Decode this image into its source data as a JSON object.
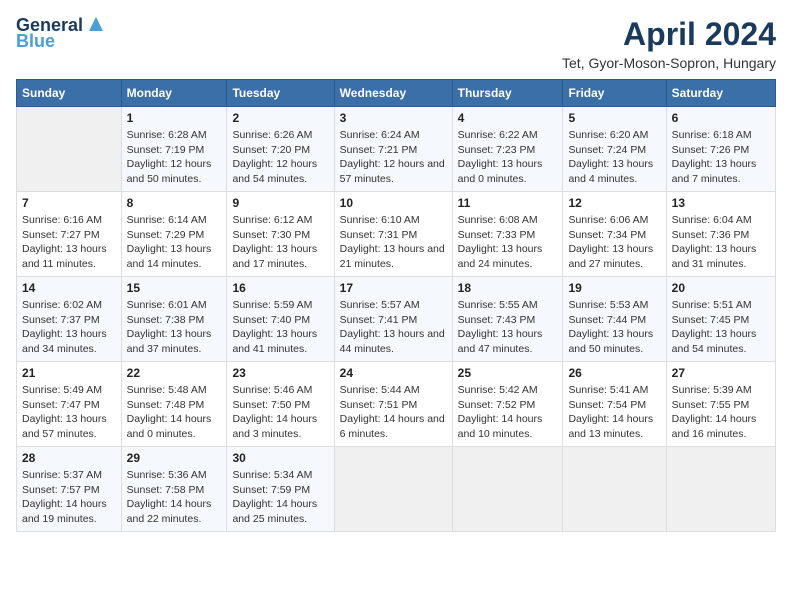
{
  "logo": {
    "line1": "General",
    "line2": "Blue"
  },
  "title": "April 2024",
  "location": "Tet, Gyor-Moson-Sopron, Hungary",
  "weekdays": [
    "Sunday",
    "Monday",
    "Tuesday",
    "Wednesday",
    "Thursday",
    "Friday",
    "Saturday"
  ],
  "weeks": [
    [
      {
        "day": "",
        "sunrise": "",
        "sunset": "",
        "daylight": ""
      },
      {
        "day": "1",
        "sunrise": "Sunrise: 6:28 AM",
        "sunset": "Sunset: 7:19 PM",
        "daylight": "Daylight: 12 hours and 50 minutes."
      },
      {
        "day": "2",
        "sunrise": "Sunrise: 6:26 AM",
        "sunset": "Sunset: 7:20 PM",
        "daylight": "Daylight: 12 hours and 54 minutes."
      },
      {
        "day": "3",
        "sunrise": "Sunrise: 6:24 AM",
        "sunset": "Sunset: 7:21 PM",
        "daylight": "Daylight: 12 hours and 57 minutes."
      },
      {
        "day": "4",
        "sunrise": "Sunrise: 6:22 AM",
        "sunset": "Sunset: 7:23 PM",
        "daylight": "Daylight: 13 hours and 0 minutes."
      },
      {
        "day": "5",
        "sunrise": "Sunrise: 6:20 AM",
        "sunset": "Sunset: 7:24 PM",
        "daylight": "Daylight: 13 hours and 4 minutes."
      },
      {
        "day": "6",
        "sunrise": "Sunrise: 6:18 AM",
        "sunset": "Sunset: 7:26 PM",
        "daylight": "Daylight: 13 hours and 7 minutes."
      }
    ],
    [
      {
        "day": "7",
        "sunrise": "Sunrise: 6:16 AM",
        "sunset": "Sunset: 7:27 PM",
        "daylight": "Daylight: 13 hours and 11 minutes."
      },
      {
        "day": "8",
        "sunrise": "Sunrise: 6:14 AM",
        "sunset": "Sunset: 7:29 PM",
        "daylight": "Daylight: 13 hours and 14 minutes."
      },
      {
        "day": "9",
        "sunrise": "Sunrise: 6:12 AM",
        "sunset": "Sunset: 7:30 PM",
        "daylight": "Daylight: 13 hours and 17 minutes."
      },
      {
        "day": "10",
        "sunrise": "Sunrise: 6:10 AM",
        "sunset": "Sunset: 7:31 PM",
        "daylight": "Daylight: 13 hours and 21 minutes."
      },
      {
        "day": "11",
        "sunrise": "Sunrise: 6:08 AM",
        "sunset": "Sunset: 7:33 PM",
        "daylight": "Daylight: 13 hours and 24 minutes."
      },
      {
        "day": "12",
        "sunrise": "Sunrise: 6:06 AM",
        "sunset": "Sunset: 7:34 PM",
        "daylight": "Daylight: 13 hours and 27 minutes."
      },
      {
        "day": "13",
        "sunrise": "Sunrise: 6:04 AM",
        "sunset": "Sunset: 7:36 PM",
        "daylight": "Daylight: 13 hours and 31 minutes."
      }
    ],
    [
      {
        "day": "14",
        "sunrise": "Sunrise: 6:02 AM",
        "sunset": "Sunset: 7:37 PM",
        "daylight": "Daylight: 13 hours and 34 minutes."
      },
      {
        "day": "15",
        "sunrise": "Sunrise: 6:01 AM",
        "sunset": "Sunset: 7:38 PM",
        "daylight": "Daylight: 13 hours and 37 minutes."
      },
      {
        "day": "16",
        "sunrise": "Sunrise: 5:59 AM",
        "sunset": "Sunset: 7:40 PM",
        "daylight": "Daylight: 13 hours and 41 minutes."
      },
      {
        "day": "17",
        "sunrise": "Sunrise: 5:57 AM",
        "sunset": "Sunset: 7:41 PM",
        "daylight": "Daylight: 13 hours and 44 minutes."
      },
      {
        "day": "18",
        "sunrise": "Sunrise: 5:55 AM",
        "sunset": "Sunset: 7:43 PM",
        "daylight": "Daylight: 13 hours and 47 minutes."
      },
      {
        "day": "19",
        "sunrise": "Sunrise: 5:53 AM",
        "sunset": "Sunset: 7:44 PM",
        "daylight": "Daylight: 13 hours and 50 minutes."
      },
      {
        "day": "20",
        "sunrise": "Sunrise: 5:51 AM",
        "sunset": "Sunset: 7:45 PM",
        "daylight": "Daylight: 13 hours and 54 minutes."
      }
    ],
    [
      {
        "day": "21",
        "sunrise": "Sunrise: 5:49 AM",
        "sunset": "Sunset: 7:47 PM",
        "daylight": "Daylight: 13 hours and 57 minutes."
      },
      {
        "day": "22",
        "sunrise": "Sunrise: 5:48 AM",
        "sunset": "Sunset: 7:48 PM",
        "daylight": "Daylight: 14 hours and 0 minutes."
      },
      {
        "day": "23",
        "sunrise": "Sunrise: 5:46 AM",
        "sunset": "Sunset: 7:50 PM",
        "daylight": "Daylight: 14 hours and 3 minutes."
      },
      {
        "day": "24",
        "sunrise": "Sunrise: 5:44 AM",
        "sunset": "Sunset: 7:51 PM",
        "daylight": "Daylight: 14 hours and 6 minutes."
      },
      {
        "day": "25",
        "sunrise": "Sunrise: 5:42 AM",
        "sunset": "Sunset: 7:52 PM",
        "daylight": "Daylight: 14 hours and 10 minutes."
      },
      {
        "day": "26",
        "sunrise": "Sunrise: 5:41 AM",
        "sunset": "Sunset: 7:54 PM",
        "daylight": "Daylight: 14 hours and 13 minutes."
      },
      {
        "day": "27",
        "sunrise": "Sunrise: 5:39 AM",
        "sunset": "Sunset: 7:55 PM",
        "daylight": "Daylight: 14 hours and 16 minutes."
      }
    ],
    [
      {
        "day": "28",
        "sunrise": "Sunrise: 5:37 AM",
        "sunset": "Sunset: 7:57 PM",
        "daylight": "Daylight: 14 hours and 19 minutes."
      },
      {
        "day": "29",
        "sunrise": "Sunrise: 5:36 AM",
        "sunset": "Sunset: 7:58 PM",
        "daylight": "Daylight: 14 hours and 22 minutes."
      },
      {
        "day": "30",
        "sunrise": "Sunrise: 5:34 AM",
        "sunset": "Sunset: 7:59 PM",
        "daylight": "Daylight: 14 hours and 25 minutes."
      },
      {
        "day": "",
        "sunrise": "",
        "sunset": "",
        "daylight": ""
      },
      {
        "day": "",
        "sunrise": "",
        "sunset": "",
        "daylight": ""
      },
      {
        "day": "",
        "sunrise": "",
        "sunset": "",
        "daylight": ""
      },
      {
        "day": "",
        "sunrise": "",
        "sunset": "",
        "daylight": ""
      }
    ]
  ]
}
